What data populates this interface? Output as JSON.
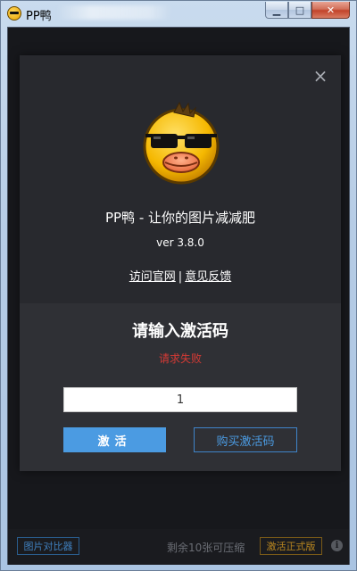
{
  "window": {
    "title": "PP鸭",
    "controls": {
      "minimize": "▁",
      "maximize": "□",
      "close": "✕"
    }
  },
  "modal": {
    "close_glyph": "×",
    "app_name": "PP鸭 - 让你的图片减减肥",
    "version": "ver 3.8.0",
    "links": {
      "website": "访问官网",
      "separator": "|",
      "feedback": "意见反馈"
    },
    "activation": {
      "title": "请输入激活码",
      "error": "请求失败",
      "code_value": "1",
      "activate_label": "激活",
      "buy_label": "购买激活码"
    }
  },
  "bottom_bar": {
    "compare_label": "图片对比器",
    "remaining_text": "剩余10张可压缩",
    "pro_label": "激活正式版",
    "info_glyph": "i"
  },
  "colors": {
    "accent_blue": "#4b9be2",
    "error_red": "#d63a35",
    "pro_gold": "#b88620",
    "modal_bg": "#28292e"
  },
  "icons": [
    "app-duck-icon",
    "duck-logo-icon",
    "close-icon",
    "info-icon"
  ]
}
